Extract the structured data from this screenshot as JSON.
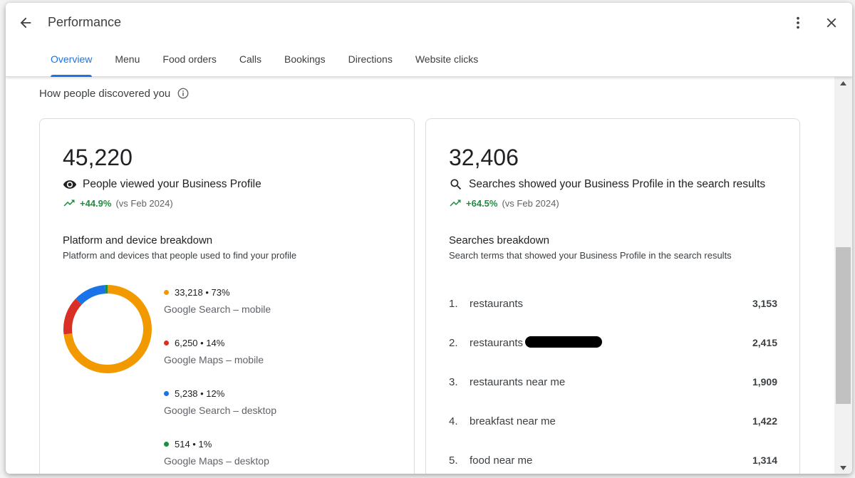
{
  "dialog": {
    "title": "Performance",
    "tabs": [
      {
        "label": "Overview",
        "active": true
      },
      {
        "label": "Menu",
        "active": false
      },
      {
        "label": "Food orders",
        "active": false
      },
      {
        "label": "Calls",
        "active": false
      },
      {
        "label": "Bookings",
        "active": false
      },
      {
        "label": "Directions",
        "active": false
      },
      {
        "label": "Website clicks",
        "active": false
      }
    ],
    "section_title": "How people discovered you"
  },
  "views_card": {
    "total": "45,220",
    "metric_label": "People viewed your Business Profile",
    "trend_pct": "+44.9%",
    "trend_vs": "(vs Feb 2024)",
    "breakdown_title": "Platform and device breakdown",
    "breakdown_desc": "Platform and devices that people used to find your profile",
    "breakdown": [
      {
        "value": "33,218 • 73%",
        "label": "Google Search – mobile",
        "color": "#f29900",
        "share": 73
      },
      {
        "value": "6,250 • 14%",
        "label": "Google Maps – mobile",
        "color": "#d93025",
        "share": 14
      },
      {
        "value": "5,238 • 12%",
        "label": "Google Search – desktop",
        "color": "#1a73e8",
        "share": 12
      },
      {
        "value": "514 • 1%",
        "label": "Google Maps – desktop",
        "color": "#1e8e3e",
        "share": 1
      }
    ]
  },
  "searches_card": {
    "total": "32,406",
    "metric_label": "Searches showed your Business Profile in the search results",
    "trend_pct": "+64.5%",
    "trend_vs": "(vs Feb 2024)",
    "breakdown_title": "Searches breakdown",
    "breakdown_desc": "Search terms that showed your Business Profile in the search results",
    "terms": [
      {
        "rank": "1.",
        "term": "restaurants",
        "count": "3,153"
      },
      {
        "rank": "2.",
        "term": "restaurants",
        "count": "2,415"
      },
      {
        "rank": "3.",
        "term": "restaurants near me",
        "count": "1,909"
      },
      {
        "rank": "4.",
        "term": "breakfast near me",
        "count": "1,422"
      },
      {
        "rank": "5.",
        "term": "food near me",
        "count": "1,314"
      }
    ]
  },
  "colors": {
    "accent": "#1a73e8",
    "trend_green": "#1e8e3e"
  },
  "icons": {
    "back": "arrow-back-icon",
    "more": "more-vert-icon",
    "close": "close-icon",
    "info": "info-icon",
    "views": "eye-icon",
    "searches": "search-icon",
    "trend": "trending-up-icon"
  }
}
